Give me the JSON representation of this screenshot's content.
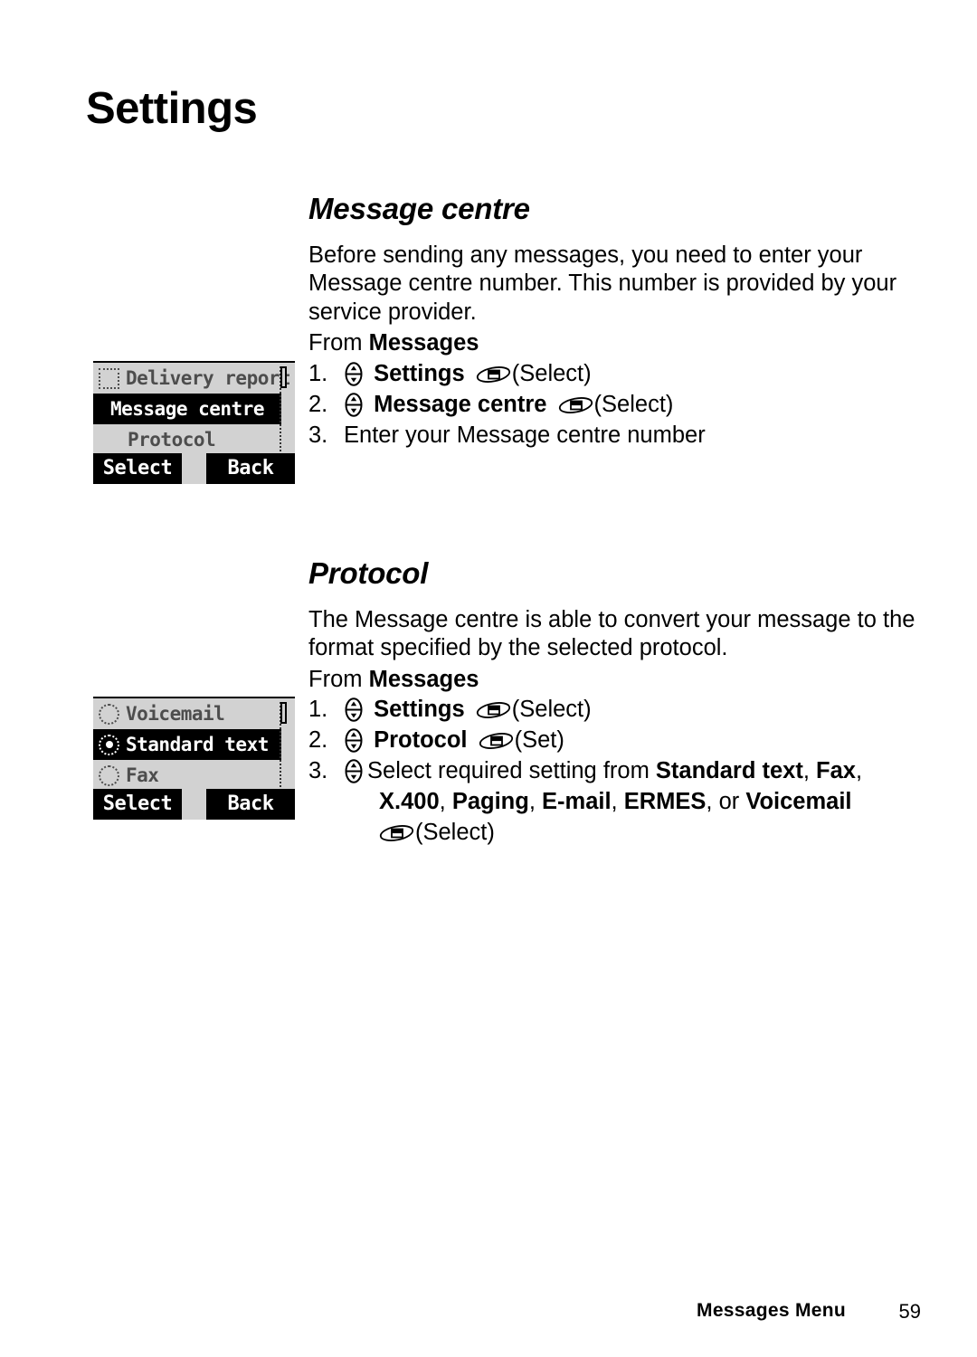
{
  "page": {
    "title": "Settings",
    "footer_label": "Messages Menu",
    "footer_page": "59"
  },
  "icons": {
    "nav_key": "nav-updown-key-icon",
    "soft_key": "soft-key-icon",
    "checkbox_off": "checkbox-unchecked-icon",
    "radio_off": "radio-unselected-icon",
    "radio_on": "radio-selected-icon",
    "scrollbar": "scrollbar-icon"
  },
  "sections": [
    {
      "heading": "Message centre",
      "paragraph": "Before sending any messages, you need to enter your Message centre number. This number is provided by your service provider.",
      "from_prefix": "From ",
      "from_target": "Messages",
      "steps": [
        {
          "num": "1.",
          "nav": true,
          "bold_text": "Settings",
          "plain_text": "",
          "soft": true,
          "soft_label": "(Select)"
        },
        {
          "num": "2.",
          "nav": true,
          "bold_text": "Message centre",
          "plain_text": "",
          "soft": true,
          "soft_label": "(Select)"
        },
        {
          "num": "3.",
          "nav": false,
          "bold_text": "",
          "plain_text": "Enter your Message centre number",
          "soft": false,
          "soft_label": ""
        }
      ]
    },
    {
      "heading": "Protocol",
      "paragraph": "The Message centre is able to convert your message to the format specified by the selected protocol.",
      "from_prefix": "From ",
      "from_target": "Messages",
      "steps": [
        {
          "num": "1.",
          "nav": true,
          "bold_text": "Settings",
          "plain_text": "",
          "soft": true,
          "soft_label": "(Select)"
        },
        {
          "num": "2.",
          "nav": true,
          "bold_text": "Protocol",
          "plain_text": "",
          "soft": true,
          "soft_label": "(Set)"
        }
      ],
      "step3": {
        "num": "3.",
        "lead": "Select required setting from ",
        "opt1": "Standard text",
        "sep1": ", ",
        "opt2": "Fax",
        "sep2": ", ",
        "opt3": "X",
        "opt3b": ".400",
        "sep3": ", ",
        "opt4": "Paging",
        "sep4": ", ",
        "opt5": "E-mail",
        "sep5": ", ",
        "opt6": "ERMES",
        "sep6": ", or ",
        "opt7": "Voicemail",
        "soft_label": "(Select)"
      }
    }
  ],
  "phone_screens": [
    {
      "id": "message-centre-menu",
      "rows": [
        {
          "mark": "square-off",
          "label": "Delivery report",
          "selected": false
        },
        {
          "mark": "none",
          "label": "Message centre",
          "selected": true
        },
        {
          "mark": "none",
          "label": "Protocol",
          "selected": false
        }
      ],
      "softkeys": {
        "left": "Select",
        "right": "Back"
      }
    },
    {
      "id": "protocol-menu",
      "rows": [
        {
          "mark": "radio-off",
          "label": "Voicemail",
          "selected": false
        },
        {
          "mark": "radio-on",
          "label": "Standard text",
          "selected": true
        },
        {
          "mark": "radio-off",
          "label": "Fax",
          "selected": false
        }
      ],
      "softkeys": {
        "left": "Select",
        "right": "Back"
      }
    }
  ]
}
